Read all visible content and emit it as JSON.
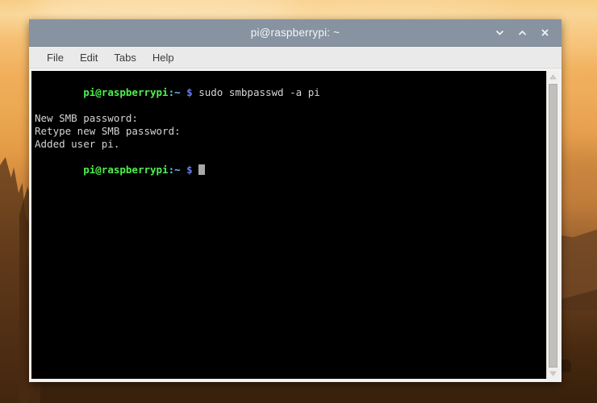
{
  "desktop": {
    "wallpaper_name": "sunset-landscape-wallpaper",
    "colors": {
      "sky_top": "#f7cd85",
      "sky_mid": "#eba851",
      "ground": "#38200c",
      "cliff": "#5e3819"
    }
  },
  "window": {
    "title": "pi@raspberrypi: ~",
    "titlebar_color": "#8793a0",
    "controls": [
      {
        "name": "minimize",
        "glyph": "chevron-down"
      },
      {
        "name": "maximize",
        "glyph": "chevron-up"
      },
      {
        "name": "close",
        "glyph": "x"
      }
    ]
  },
  "menubar": {
    "items": [
      {
        "label": "File"
      },
      {
        "label": "Edit"
      },
      {
        "label": "Tabs"
      },
      {
        "label": "Help"
      }
    ]
  },
  "terminal": {
    "background": "#000000",
    "foreground": "#d4d4d4",
    "prompt_user_color": "#4ef04e",
    "prompt_path_color": "#63c8ef",
    "prompt_dollar_color": "#6a7ef2",
    "prompt": {
      "user": "pi@raspberrypi",
      "path": ":~",
      "dollar": "$"
    },
    "lines": [
      {
        "type": "prompt",
        "command": " sudo smbpasswd -a pi"
      },
      {
        "type": "output",
        "text": "New SMB password:"
      },
      {
        "type": "output",
        "text": "Retype new SMB password:"
      },
      {
        "type": "output",
        "text": "Added user pi."
      },
      {
        "type": "prompt",
        "command": " ",
        "cursor": true
      }
    ]
  },
  "scrollbar": {
    "up_arrow": "▲",
    "down_arrow": "▼",
    "thumb_color": "#c2c0bd"
  }
}
